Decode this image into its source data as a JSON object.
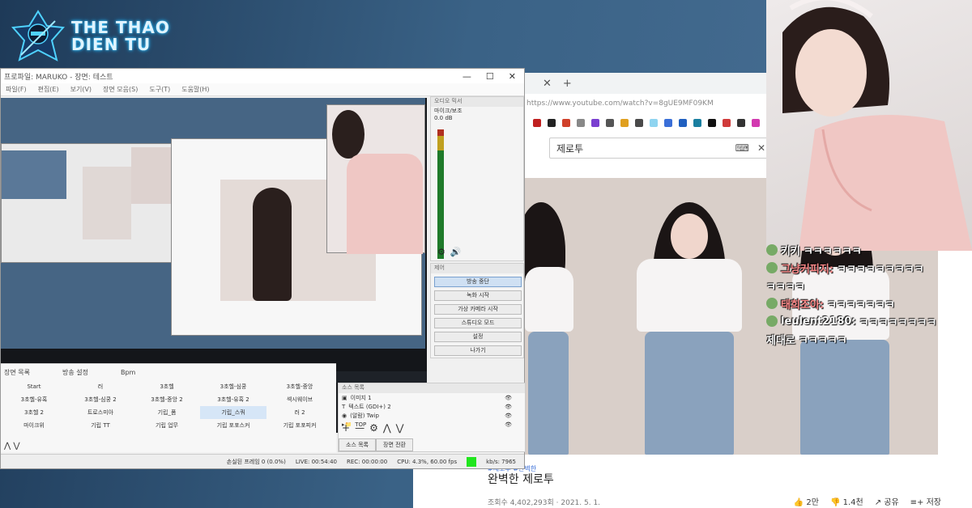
{
  "site": {
    "logo_line1": "THE THAO",
    "logo_line2": "DIEN TU"
  },
  "obs": {
    "titlebar": "프로파일: MARUKO - 장면: 테스트",
    "window_controls": [
      "—",
      "☐",
      "✕"
    ],
    "menu": [
      "파일(F)",
      "편집(E)",
      "보기(V)",
      "장면 모음(S)",
      "도구(T)",
      "도움말(H)"
    ],
    "mixer_title": "오디오 믹서",
    "mixer_channel": "마이크/보조",
    "mixer_db": "0.0 dB",
    "controls_title": "제어",
    "controls": [
      "방송 중단",
      "녹화 시작",
      "가상 카메라 시작",
      "스튜디오 모드",
      "설정",
      "나가기"
    ],
    "scenes_tabs": [
      "장면 목록",
      "방송 설정",
      "Bpm"
    ],
    "scenes": [
      "Start",
      "러",
      "3초헬",
      "3초헬-심쿵",
      "3초헬-중앙",
      "3초헬-유혹",
      "3초헬-심쿵 2",
      "3초헬-중앙 2",
      "3초헬-유혹 2",
      "섹시웨이브",
      "3초헬 2",
      "트로스미아",
      "기립_폼",
      "기립_스쿼",
      "러 2",
      "마이크위",
      "기립 TT",
      "기립 업무",
      "기립 포포스커",
      "기립 포포피커"
    ],
    "selected_scene_index": 13,
    "sources_title": "소스 목록",
    "sources": [
      "이미지 1",
      "텍스트 (GDI+) 2",
      "(알람) Twip",
      "TOP"
    ],
    "sources_tabs": [
      "소스 목록",
      "장면 전환"
    ],
    "status": {
      "dropped": "손실된 프레임 0 (0.0%)",
      "live": "LIVE: 00:54:40",
      "rec": "REC: 00:00:00",
      "cpu": "CPU: 4.3%, 60.00 fps",
      "bitrate": "kb/s: 7965"
    },
    "status_color": "#21e61e"
  },
  "browser": {
    "tab_close": "✕",
    "tab_add": "+",
    "url": "https://www.youtube.com/watch?v=8gUE9MF09KM",
    "search_value": "제로투",
    "video_tag": "#제로투 #완벽한",
    "video_title": "완벽한 제로투",
    "video_meta": "조회수 4,402,293회 · 2021. 5. 1.",
    "actions": [
      "👍 2만",
      "👎 1.4천",
      "↗ 공유",
      "≡+ 저장"
    ]
  },
  "chat": [
    {
      "nick": "키키",
      "msg": "ㅋㅋㅋㅋㅋㅋ"
    },
    {
      "nick": "그냥커피지:",
      "msg": "ㅋㅋㅋㅋㅋㅋㅋㅋㅋ"
    },
    {
      "nick": "ㅋㅋㅋㅋ",
      "msg": ""
    },
    {
      "nick": "태희조아:",
      "msg": "ㅋㅋㅋㅋㅋㅋㅋ"
    },
    {
      "nick": "leulent2180:",
      "msg": "ㅋㅋㅋㅋㅋㅋㅋㅋ"
    },
    {
      "nick": "제대로",
      "msg": "ㅋㅋㅋㅋㅋ"
    }
  ],
  "colors": {
    "logo_glow": "#33c6ff",
    "primary_button": "#cfe0f3",
    "chat_nick": "#ff8b8b"
  }
}
